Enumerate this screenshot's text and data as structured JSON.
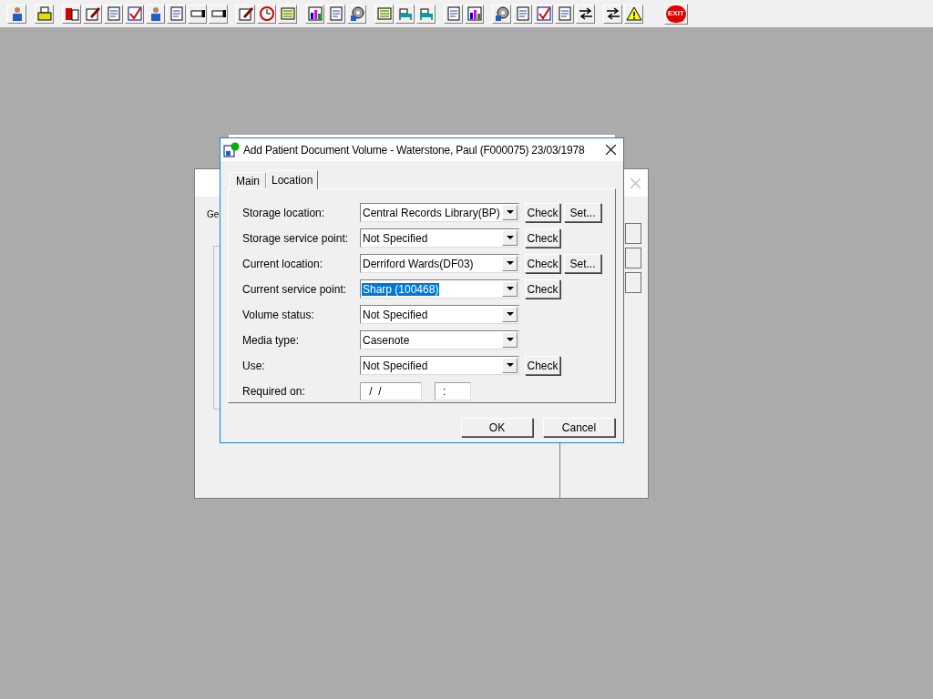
{
  "toolbar": {
    "exit_label": "EXIT"
  },
  "background_window": {
    "tab_label": "Ge"
  },
  "dialog": {
    "title": "Add Patient Document Volume - Waterstone, Paul (F000075) 23/03/1978",
    "tabs": [
      {
        "label": "Main",
        "selected": false
      },
      {
        "label": "Location",
        "selected": true
      }
    ],
    "rows": [
      {
        "kind": "combo",
        "label": "Storage location:",
        "value": "Central Records Library(BP)",
        "value_selected": false,
        "buttons": [
          "Check",
          "Set..."
        ]
      },
      {
        "kind": "combo",
        "label": "Storage service point:",
        "value": "Not Specified",
        "value_selected": false,
        "buttons": [
          "Check"
        ]
      },
      {
        "kind": "combo",
        "label": "Current location:",
        "value": "Derriford Wards(DF03)",
        "value_selected": false,
        "buttons": [
          "Check",
          "Set..."
        ]
      },
      {
        "kind": "combo",
        "label": "Current service point:",
        "value": "Sharp (100468)",
        "value_selected": true,
        "buttons": [
          "Check"
        ]
      },
      {
        "kind": "combo",
        "label": "Volume status:",
        "value": "Not Specified",
        "value_selected": false
      },
      {
        "kind": "combo",
        "label": "Media type:",
        "value": "Casenote",
        "value_selected": false
      },
      {
        "kind": "combo",
        "label": "Use:",
        "value": "Not Specified",
        "value_selected": false,
        "buttons": [
          "Check"
        ]
      },
      {
        "kind": "datetime",
        "label": "Required on:",
        "date": " /  /",
        "time": ":"
      }
    ],
    "buttons": [
      "OK",
      "Cancel"
    ]
  }
}
